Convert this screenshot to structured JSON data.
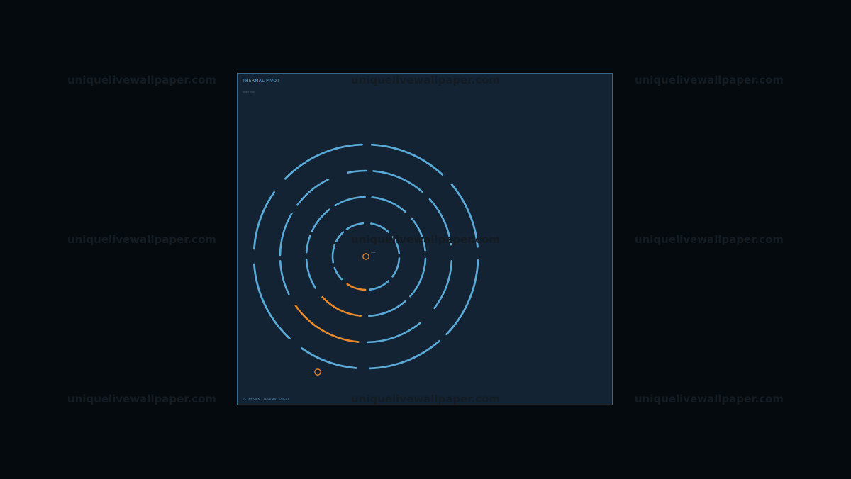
{
  "watermark": {
    "text": "uniquelivewallpaper.com"
  },
  "panel": {
    "title": "THERMAL PIVOT",
    "subtitle": "ORBIT MAP",
    "footer": "RELAY SPIN · THERMAL SWEEP"
  },
  "center": {
    "label": "ORB"
  },
  "colors": {
    "background": "#050a0e",
    "panel": "#132334",
    "ring": "#5aaad8",
    "accent": "#e8882a",
    "watermark": "#141c23"
  },
  "rings": [
    {
      "name": "ring-1",
      "segments": [
        [
          3,
          37
        ],
        [
          47,
          83
        ],
        [
          91,
          124
        ],
        [
          137,
          160
        ],
        [
          170,
          200
        ],
        [
          207,
          227
        ],
        [
          235,
          265
        ],
        [
          279,
          313
        ],
        [
          324,
          354
        ]
      ],
      "highlight": [
        [
          91,
          124
        ]
      ]
    },
    {
      "name": "ring-2",
      "segments": [
        [
          2,
          42
        ],
        [
          49,
          87
        ],
        [
          95,
          137
        ],
        [
          148,
          177
        ],
        [
          184,
          200
        ],
        [
          205,
          232
        ],
        [
          239,
          269
        ],
        [
          276,
          311
        ],
        [
          321,
          354
        ]
      ],
      "highlight": [
        [
          95,
          137
        ]
      ]
    },
    {
      "name": "ring-3",
      "segments": [
        [
          3,
          37
        ],
        [
          51,
          89
        ],
        [
          95,
          145
        ],
        [
          154,
          177
        ],
        [
          181,
          210
        ],
        [
          217,
          244
        ],
        [
          258,
          270
        ],
        [
          275,
          311
        ],
        [
          318,
          352
        ]
      ],
      "highlight": [
        [
          95,
          145
        ]
      ]
    },
    {
      "name": "ring-4",
      "segments": [
        [
          2,
          44
        ],
        [
          49,
          88
        ],
        [
          95,
          125
        ],
        [
          133,
          176
        ],
        [
          184,
          215
        ],
        [
          224,
          268
        ],
        [
          273,
          313
        ],
        [
          320,
          355
        ]
      ],
      "highlight": []
    }
  ],
  "markers": [
    {
      "name": "center-marker",
      "color": "accent"
    },
    {
      "name": "offset-marker",
      "color": "accent"
    }
  ]
}
